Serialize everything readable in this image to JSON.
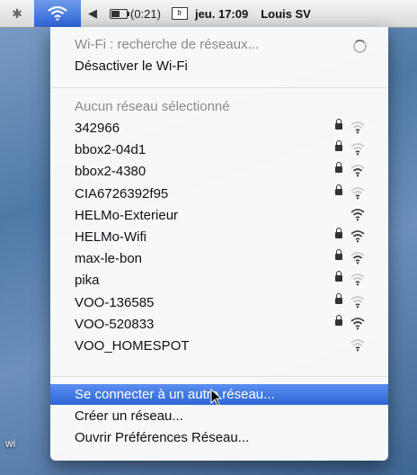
{
  "menubar": {
    "battery_time": "(0:21)",
    "flag_label": "fr",
    "clock": "jeu. 17:09",
    "user": "Louis SV"
  },
  "menu": {
    "status": "Wi-Fi : recherche de réseaux...",
    "toggle": "Désactiver le Wi-Fi",
    "no_network": "Aucun réseau sélectionné",
    "networks": [
      {
        "name": "342966",
        "locked": true,
        "signal": 1
      },
      {
        "name": "bbox2-04d1",
        "locked": true,
        "signal": 1
      },
      {
        "name": "bbox2-4380",
        "locked": true,
        "signal": 2
      },
      {
        "name": "CIA6726392f95",
        "locked": true,
        "signal": 1
      },
      {
        "name": "HELMo-Exterieur",
        "locked": false,
        "signal": 3
      },
      {
        "name": "HELMo-Wifi",
        "locked": true,
        "signal": 3
      },
      {
        "name": "max-le-bon",
        "locked": true,
        "signal": 2
      },
      {
        "name": "pika",
        "locked": true,
        "signal": 1
      },
      {
        "name": "VOO-136585",
        "locked": true,
        "signal": 1
      },
      {
        "name": "VOO-520833",
        "locked": true,
        "signal": 3
      },
      {
        "name": "VOO_HOMESPOT",
        "locked": false,
        "signal": 1
      }
    ],
    "actions": {
      "other": "Se connecter à un autre réseau...",
      "create": "Créer un réseau...",
      "prefs": "Ouvrir Préférences Réseau..."
    }
  },
  "desktop": {
    "label_left": "wi"
  },
  "colors": {
    "highlight": "#3a72e0",
    "wifi_active": "#2d64d8"
  }
}
